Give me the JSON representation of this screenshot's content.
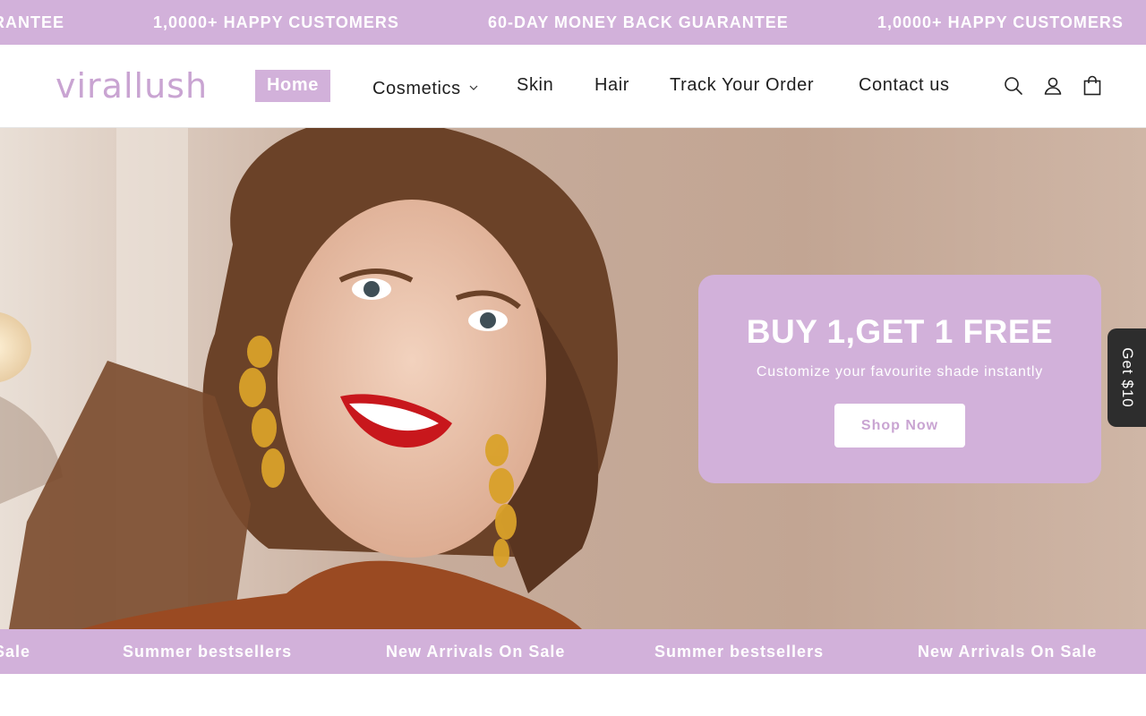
{
  "announcement": {
    "items": [
      "RANTEE",
      "1,0000+ HAPPY CUSTOMERS",
      "60-DAY MONEY BACK GUARANTEE",
      "1,0000+ HAPPY CUSTOMERS"
    ]
  },
  "header": {
    "logo": "virallush",
    "nav": [
      {
        "label": "Home",
        "active": true
      },
      {
        "label": "Cosmetics",
        "has_dropdown": true
      },
      {
        "label": "Skin"
      },
      {
        "label": "Hair"
      },
      {
        "label": "Track Your Order"
      },
      {
        "label": "Contact us"
      }
    ],
    "icons": [
      "search-icon",
      "account-icon",
      "cart-icon"
    ]
  },
  "hero": {
    "title": "BUY 1,GET 1 FREE",
    "subtitle": "Customize your favourite shade instantly",
    "cta": "Shop Now"
  },
  "side_tab": {
    "label": "Get $10"
  },
  "ticker": {
    "items": [
      "Sale",
      "Summer bestsellers",
      "New Arrivals On Sale",
      "Summer bestsellers",
      "New Arrivals On Sale"
    ]
  },
  "colors": {
    "accent": "#d2b1da",
    "logo": "#c9a4d2",
    "side_tab": "#2d2d2d"
  }
}
